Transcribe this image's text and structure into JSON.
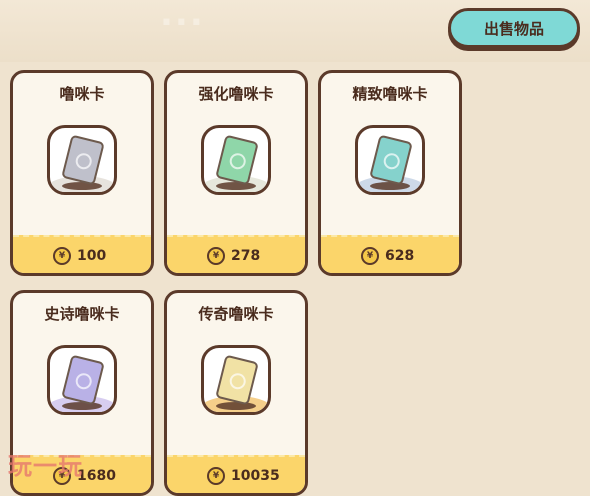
{
  "header": {
    "faded_title": "...",
    "sell_button": "出售物品"
  },
  "cards": [
    {
      "name": "噜咪卡",
      "price": "100",
      "color": "#bfc0cb",
      "ground": "#e7e3dd"
    },
    {
      "name": "强化噜咪卡",
      "price": "278",
      "color": "#8fd6a9",
      "ground": "#e6e8dc"
    },
    {
      "name": "精致噜咪卡",
      "price": "628",
      "color": "#85d2cc",
      "ground": "#cdd9e8"
    },
    {
      "name": "史诗噜咪卡",
      "price": "1680",
      "color": "#b9b1e6",
      "ground": "#d7cdf0"
    },
    {
      "name": "传奇噜咪卡",
      "price": "10035",
      "color": "#f1e2a5",
      "ground": "#f5cf8a"
    }
  ],
  "watermark": "玩一玩"
}
